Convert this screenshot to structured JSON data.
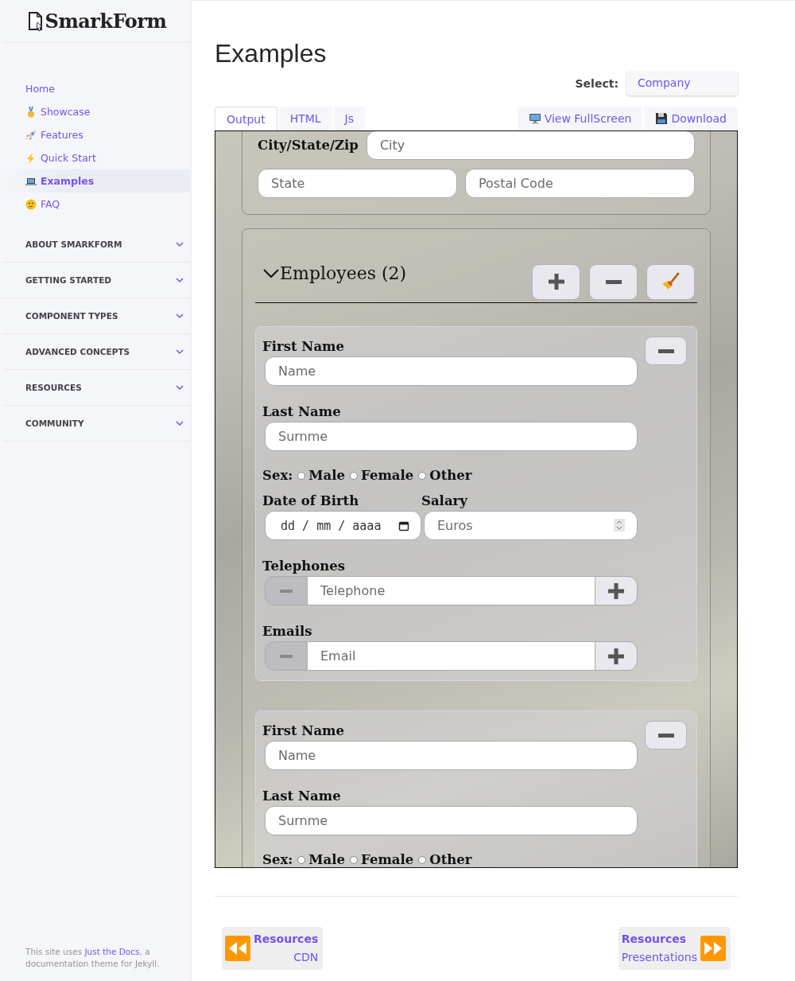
{
  "sidebar": {
    "logo": "SmarkForm",
    "nav": [
      {
        "label": "Home",
        "selected": false
      },
      {
        "label": "Showcase",
        "selected": false
      },
      {
        "label": "Features",
        "selected": false
      },
      {
        "label": "Quick Start",
        "selected": false
      },
      {
        "label": "Examples",
        "selected": true
      },
      {
        "label": "FAQ",
        "selected": false
      }
    ],
    "sections": [
      {
        "label": "ABOUT SMARKFORM",
        "expanded": false
      },
      {
        "label": "GETTING STARTED",
        "expanded": false
      },
      {
        "label": "COMPONENT TYPES",
        "expanded": false
      },
      {
        "label": "ADVANCED CONCEPTS",
        "expanded": false
      },
      {
        "label": "RESOURCES",
        "expanded": false
      },
      {
        "label": "COMMUNITY",
        "expanded": false
      }
    ],
    "footer": {
      "before": "This site uses ",
      "link": "Just the Docs",
      "after": ", a documentation theme for Jekyll."
    }
  },
  "page": {
    "title": "Examples",
    "select_label": "Select:",
    "select_value": "Company",
    "tabs": [
      {
        "label": "Output",
        "selected": true
      },
      {
        "label": "HTML",
        "selected": false
      },
      {
        "label": "Js",
        "selected": false
      }
    ],
    "actions": [
      {
        "label": "View FullScreen"
      },
      {
        "label": "Download"
      }
    ]
  },
  "form": {
    "address": {
      "label": "City/State/Zip",
      "city": {
        "placeholder": "City"
      },
      "state": {
        "placeholder": "State"
      },
      "postal": {
        "placeholder": "Postal Code"
      }
    },
    "employees_title": "Employees (2)",
    "expanded": true,
    "employees": [
      {
        "first_name": {
          "label": "First Name",
          "placeholder": "Name"
        },
        "last_name": {
          "label": "Last Name",
          "placeholder": "Surnme"
        },
        "sex_label": "Sex:",
        "sex": [
          {
            "label": "Male",
            "checked": false
          },
          {
            "label": "Female",
            "checked": false
          },
          {
            "label": "Other",
            "checked": false
          }
        ],
        "date_of_birth": {
          "label": "Date of Birth",
          "value": "dd / mm / aaaa"
        },
        "salary": {
          "label": "Salary",
          "placeholder": "Euros"
        },
        "telephones": {
          "label": "Telephones",
          "placeholder": "Telephone"
        },
        "emails": {
          "label": "Emails",
          "placeholder": "Email"
        }
      },
      {
        "first_name": {
          "label": "First Name",
          "placeholder": "Name"
        },
        "last_name": {
          "label": "Last Name",
          "placeholder": "Surnme"
        },
        "sex_label": "Sex:",
        "sex": [
          {
            "label": "Male",
            "checked": false
          },
          {
            "label": "Female",
            "checked": false
          },
          {
            "label": "Other",
            "checked": false
          }
        ]
      }
    ]
  },
  "pager": {
    "prev": {
      "title": "Resources",
      "subtitle": "CDN"
    },
    "next": {
      "title": "Resources",
      "subtitle": "Presentations"
    }
  }
}
